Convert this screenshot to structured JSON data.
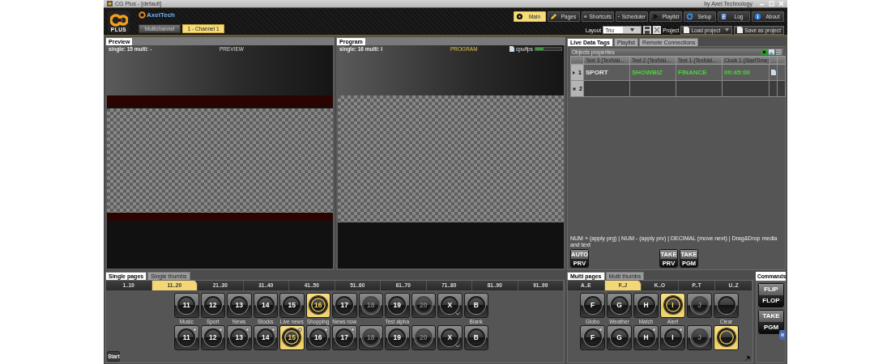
{
  "window": {
    "title": "CG Plus - [default]",
    "subtitle": "by Axel Technology"
  },
  "logo": {
    "text": "PLUS",
    "brand": "AxelTech"
  },
  "channel_tabs": [
    {
      "label": "Multichannel",
      "selected": false
    },
    {
      "label": "1 - Channel 1",
      "selected": true
    }
  ],
  "nav_buttons": [
    {
      "label": "Main",
      "selected": true
    },
    {
      "label": "Pages",
      "selected": false
    },
    {
      "label": "Shortcuts",
      "selected": false
    },
    {
      "label": "Scheduler",
      "selected": false
    },
    {
      "label": "Playlist",
      "selected": false
    },
    {
      "label": "Setup",
      "selected": false
    },
    {
      "label": "Log",
      "selected": false
    },
    {
      "label": "About",
      "selected": false
    }
  ],
  "layout": {
    "label": "Layout",
    "value": "Trio",
    "project_label": "Project",
    "load_button": "Load project",
    "save_button": "Save as project"
  },
  "monitors": [
    {
      "kind": "preview",
      "tab": "Preview",
      "info": "single: 15 multi: -",
      "title": "PREVIEW"
    },
    {
      "kind": "program",
      "tab": "Program",
      "info": "single: 16 multi: I",
      "title": "PROGRAM",
      "cpu_label": "cpu/fps",
      "cpu_meter": {
        "level": 0.3
      }
    }
  ],
  "right_tabs": [
    {
      "label": "Live Data Tags",
      "selected": true
    },
    {
      "label": "Playlist",
      "selected": false
    },
    {
      "label": "Remote Connections",
      "selected": false
    }
  ],
  "objects_properties": {
    "title": "Objects properties",
    "columns": [
      "Text 3 (TextVal...",
      "Text 2 (TextVal...",
      "Text 1 (TextVal...",
      "Clock 1 (StartTime)"
    ],
    "rows": [
      {
        "number": "1",
        "kind": "data",
        "selected": true,
        "cells": [
          {
            "text": "SPORT",
            "color": "#e8e8e8"
          },
          {
            "text": "SHOWBIZ",
            "color": "#4cd43c"
          },
          {
            "text": "FINANCE",
            "color": "#4cd43c"
          },
          {
            "text": "00:45:00",
            "color": "#4cd43c"
          }
        ]
      },
      {
        "number": "2",
        "kind": "new",
        "selected": false
      }
    ]
  },
  "hint": "NUM + (apply prg) | NUM - (apply prv) | DECIMAL (move next) | Drag&Drop media and text",
  "take_buttons": [
    {
      "top": "AUTO",
      "bottom": "PRV"
    },
    {
      "top": "TAKE",
      "bottom": "PRV"
    },
    {
      "top": "TAKE",
      "bottom": "PGM"
    }
  ],
  "single_pages": {
    "tabs": [
      {
        "label": "Single pages",
        "selected": true
      },
      {
        "label": "Single thumbs",
        "selected": false
      }
    ],
    "ranges": [
      {
        "label": "1..10",
        "selected": false
      },
      {
        "label": "11..20",
        "selected": true
      },
      {
        "label": "21..30",
        "selected": false
      },
      {
        "label": "31..40",
        "selected": false
      },
      {
        "label": "41..50",
        "selected": false
      },
      {
        "label": "51..60",
        "selected": false
      },
      {
        "label": "61..70",
        "selected": false
      },
      {
        "label": "71..80",
        "selected": false
      },
      {
        "label": "81..90",
        "selected": false
      },
      {
        "label": "91..99",
        "selected": false
      }
    ],
    "rows": [
      {
        "buttons": [
          {
            "label": "11",
            "caption": "Music",
            "selected": false,
            "disabled": false,
            "badge": false,
            "dropdown": false
          },
          {
            "label": "12",
            "caption": "Sport",
            "selected": false,
            "disabled": false,
            "badge": false,
            "dropdown": false
          },
          {
            "label": "13",
            "caption": "News",
            "selected": false,
            "disabled": false,
            "badge": false,
            "dropdown": false
          },
          {
            "label": "14",
            "caption": "Stocks",
            "selected": false,
            "disabled": false,
            "badge": false,
            "dropdown": false
          },
          {
            "label": "15",
            "caption": "Live news",
            "selected": false,
            "disabled": false,
            "badge": false,
            "dropdown": false
          },
          {
            "label": "16",
            "caption": "Shopping",
            "selected": true,
            "disabled": false,
            "badge": false,
            "dropdown": false
          },
          {
            "label": "17",
            "caption": "News now",
            "selected": false,
            "disabled": false,
            "badge": false,
            "dropdown": false
          },
          {
            "label": "18",
            "selected": false,
            "disabled": true,
            "badge": false,
            "dropdown": false
          },
          {
            "label": "19",
            "caption": "Test alpha",
            "selected": false,
            "disabled": false,
            "badge": false,
            "dropdown": false
          },
          {
            "label": "20",
            "selected": false,
            "disabled": true,
            "badge": false,
            "dropdown": false
          },
          {
            "label": "X",
            "selected": false,
            "disabled": false,
            "badge": false,
            "dropdown": true
          },
          {
            "label": "B",
            "caption": "Blank",
            "selected": false,
            "disabled": false,
            "badge": false,
            "dropdown": false
          }
        ]
      },
      {
        "buttons": [
          {
            "label": "11",
            "selected": false,
            "disabled": false,
            "badge": true,
            "dropdown": false
          },
          {
            "label": "12",
            "selected": false,
            "disabled": false,
            "badge": true,
            "dropdown": false
          },
          {
            "label": "13",
            "selected": false,
            "disabled": false,
            "badge": true,
            "dropdown": false
          },
          {
            "label": "14",
            "selected": false,
            "disabled": false,
            "badge": true,
            "dropdown": false
          },
          {
            "label": "15",
            "selected": true,
            "disabled": false,
            "badge": true,
            "dropdown": false
          },
          {
            "label": "16",
            "selected": false,
            "disabled": false,
            "badge": true,
            "dropdown": false
          },
          {
            "label": "17",
            "selected": false,
            "disabled": false,
            "badge": true,
            "dropdown": false
          },
          {
            "label": "18",
            "selected": false,
            "disabled": true,
            "badge": false,
            "dropdown": false
          },
          {
            "label": "19",
            "selected": false,
            "disabled": false,
            "badge": false,
            "dropdown": false
          },
          {
            "label": "20",
            "selected": false,
            "disabled": true,
            "badge": false,
            "dropdown": false
          },
          {
            "label": "X",
            "selected": false,
            "disabled": false,
            "badge": false,
            "dropdown": true
          },
          {
            "label": "B",
            "selected": false,
            "disabled": false,
            "badge": false,
            "dropdown": false
          }
        ]
      }
    ],
    "start_button": "Start"
  },
  "multi_pages": {
    "tabs": [
      {
        "label": "Multi pages",
        "selected": true
      },
      {
        "label": "Multi thumbs",
        "selected": false
      }
    ],
    "ranges": [
      {
        "label": "A..E",
        "selected": false
      },
      {
        "label": "F..J",
        "selected": true
      },
      {
        "label": "K..O",
        "selected": false
      },
      {
        "label": "P..T",
        "selected": false
      },
      {
        "label": "U..Z",
        "selected": false
      }
    ],
    "rows": [
      {
        "buttons": [
          {
            "label": "F",
            "caption": "Globo",
            "selected": false,
            "disabled": false,
            "badge": false,
            "dropdown": false
          },
          {
            "label": "G",
            "caption": "Weather",
            "selected": false,
            "disabled": false,
            "badge": false,
            "dropdown": false
          },
          {
            "label": "H",
            "caption": "Match",
            "selected": false,
            "disabled": false,
            "badge": false,
            "dropdown": false
          },
          {
            "label": "I",
            "caption": "Alert",
            "selected": true,
            "disabled": false,
            "badge": false,
            "dropdown": false
          },
          {
            "label": "J",
            "selected": false,
            "disabled": true,
            "badge": false,
            "dropdown": false
          },
          {
            "caption": "Clear",
            "selected": false,
            "disabled": false,
            "badge": false,
            "dropdown": false
          }
        ]
      },
      {
        "buttons": [
          {
            "label": "F",
            "selected": false,
            "disabled": false,
            "badge": true,
            "dropdown": false
          },
          {
            "label": "G",
            "selected": false,
            "disabled": false,
            "badge": false,
            "dropdown": false
          },
          {
            "label": "H",
            "selected": false,
            "disabled": false,
            "badge": true,
            "dropdown": false
          },
          {
            "label": "I",
            "selected": false,
            "disabled": false,
            "badge": true,
            "dropdown": false
          },
          {
            "label": "J",
            "selected": false,
            "disabled": true,
            "badge": false,
            "dropdown": false
          },
          {
            "selected": true,
            "disabled": false,
            "badge": false,
            "dropdown": false
          }
        ]
      }
    ]
  },
  "commands": {
    "tab": "Commands",
    "buttons": [
      {
        "top": "FLIP",
        "bottom": "FLOP"
      },
      {
        "top": "TAKE",
        "bottom": "PGM"
      }
    ]
  }
}
